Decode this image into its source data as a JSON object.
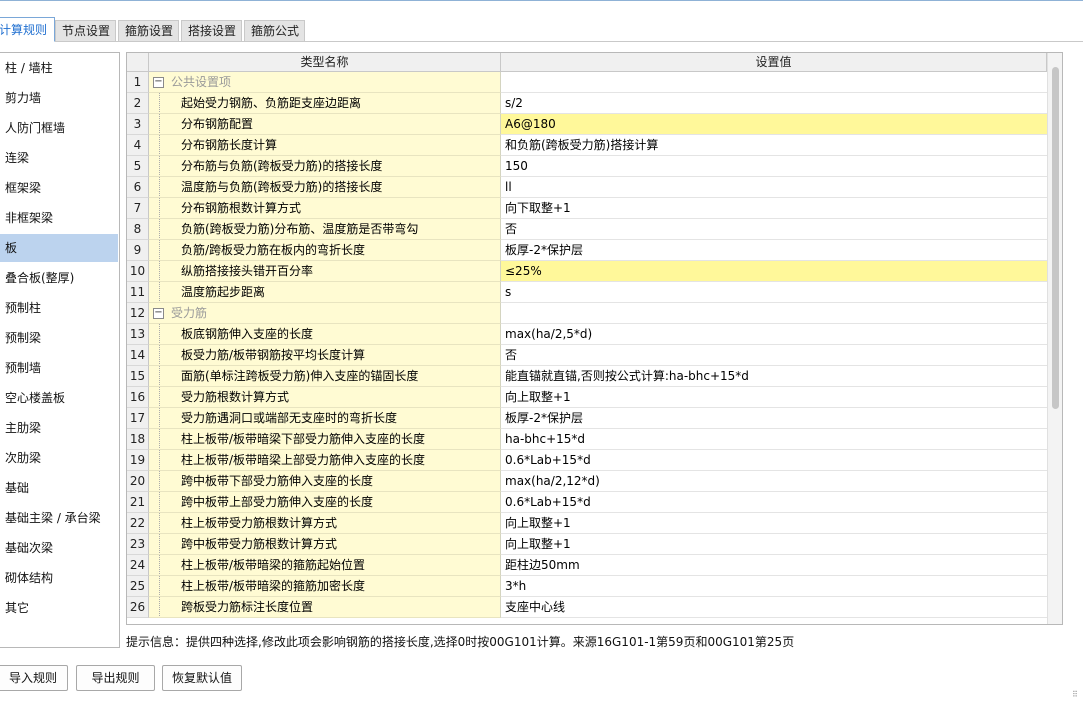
{
  "tabs": [
    {
      "label": "计算规则",
      "active": true
    },
    {
      "label": "节点设置",
      "active": false
    },
    {
      "label": "箍筋设置",
      "active": false
    },
    {
      "label": "搭接设置",
      "active": false
    },
    {
      "label": "箍筋公式",
      "active": false
    }
  ],
  "sidebar": {
    "items": [
      {
        "label": "柱 / 墙柱"
      },
      {
        "label": "剪力墙"
      },
      {
        "label": "人防门框墙"
      },
      {
        "label": "连梁"
      },
      {
        "label": "框架梁"
      },
      {
        "label": "非框架梁"
      },
      {
        "label": "板",
        "selected": true
      },
      {
        "label": "叠合板(整厚)"
      },
      {
        "label": "预制柱"
      },
      {
        "label": "预制梁"
      },
      {
        "label": "预制墙"
      },
      {
        "label": "空心楼盖板"
      },
      {
        "label": "主肋梁"
      },
      {
        "label": "次肋梁"
      },
      {
        "label": "基础"
      },
      {
        "label": "基础主梁 / 承台梁"
      },
      {
        "label": "基础次梁"
      },
      {
        "label": "砌体结构"
      },
      {
        "label": "其它"
      }
    ]
  },
  "grid": {
    "columns": {
      "name": "类型名称",
      "value": "设置值"
    },
    "rows": [
      {
        "num": "1",
        "type": "group",
        "name": "公共设置项",
        "value": "",
        "toggle": "−"
      },
      {
        "num": "2",
        "type": "item",
        "name": "起始受力钢筋、负筋距支座边距离",
        "value": "s/2"
      },
      {
        "num": "3",
        "type": "item",
        "name": "分布钢筋配置",
        "value": "A6@180",
        "highlight": true
      },
      {
        "num": "4",
        "type": "item",
        "name": "分布钢筋长度计算",
        "value": "和负筋(跨板受力筋)搭接计算"
      },
      {
        "num": "5",
        "type": "item",
        "name": "分布筋与负筋(跨板受力筋)的搭接长度",
        "value": "150"
      },
      {
        "num": "6",
        "type": "item",
        "name": "温度筋与负筋(跨板受力筋)的搭接长度",
        "value": "ll"
      },
      {
        "num": "7",
        "type": "item",
        "name": "分布钢筋根数计算方式",
        "value": "向下取整+1"
      },
      {
        "num": "8",
        "type": "item",
        "name": "负筋(跨板受力筋)分布筋、温度筋是否带弯勾",
        "value": "否"
      },
      {
        "num": "9",
        "type": "item",
        "name": "负筋/跨板受力筋在板内的弯折长度",
        "value": "板厚-2*保护层"
      },
      {
        "num": "10",
        "type": "item",
        "name": "纵筋搭接接头错开百分率",
        "value": "≤25%",
        "highlight": true
      },
      {
        "num": "11",
        "type": "item",
        "name": "温度筋起步距离",
        "value": "s"
      },
      {
        "num": "12",
        "type": "group",
        "name": "受力筋",
        "value": "",
        "toggle": "−"
      },
      {
        "num": "13",
        "type": "item",
        "name": "板底钢筋伸入支座的长度",
        "value": "max(ha/2,5*d)"
      },
      {
        "num": "14",
        "type": "item",
        "name": "板受力筋/板带钢筋按平均长度计算",
        "value": "否"
      },
      {
        "num": "15",
        "type": "item",
        "name": "面筋(单标注跨板受力筋)伸入支座的锚固长度",
        "value": "能直锚就直锚,否则按公式计算:ha-bhc+15*d"
      },
      {
        "num": "16",
        "type": "item",
        "name": "受力筋根数计算方式",
        "value": "向上取整+1"
      },
      {
        "num": "17",
        "type": "item",
        "name": "受力筋遇洞口或端部无支座时的弯折长度",
        "value": "板厚-2*保护层"
      },
      {
        "num": "18",
        "type": "item",
        "name": "柱上板带/板带暗梁下部受力筋伸入支座的长度",
        "value": "ha-bhc+15*d"
      },
      {
        "num": "19",
        "type": "item",
        "name": "柱上板带/板带暗梁上部受力筋伸入支座的长度",
        "value": "0.6*Lab+15*d"
      },
      {
        "num": "20",
        "type": "item",
        "name": "跨中板带下部受力筋伸入支座的长度",
        "value": "max(ha/2,12*d)"
      },
      {
        "num": "21",
        "type": "item",
        "name": "跨中板带上部受力筋伸入支座的长度",
        "value": "0.6*Lab+15*d"
      },
      {
        "num": "22",
        "type": "item",
        "name": "柱上板带受力筋根数计算方式",
        "value": "向上取整+1"
      },
      {
        "num": "23",
        "type": "item",
        "name": "跨中板带受力筋根数计算方式",
        "value": "向上取整+1"
      },
      {
        "num": "24",
        "type": "item",
        "name": "柱上板带/板带暗梁的箍筋起始位置",
        "value": "距柱边50mm"
      },
      {
        "num": "25",
        "type": "item",
        "name": "柱上板带/板带暗梁的箍筋加密长度",
        "value": "3*h"
      },
      {
        "num": "26",
        "type": "item",
        "name": "跨板受力筋标注长度位置",
        "value": "支座中心线"
      }
    ]
  },
  "hint": "提示信息：提供四种选择,修改此项会影响钢筋的搭接长度,选择0时按00G101计算。来源16G101-1第59页和00G101第25页",
  "buttons": {
    "import": "导入规则",
    "export": "导出规则",
    "restore": "恢复默认值"
  },
  "colors": {
    "name_column_bg": "#fffbd3",
    "highlight_bg": "#fff89a",
    "sidebar_selected_bg": "#bcd3ee",
    "active_tab_text": "#1f6fd0"
  }
}
